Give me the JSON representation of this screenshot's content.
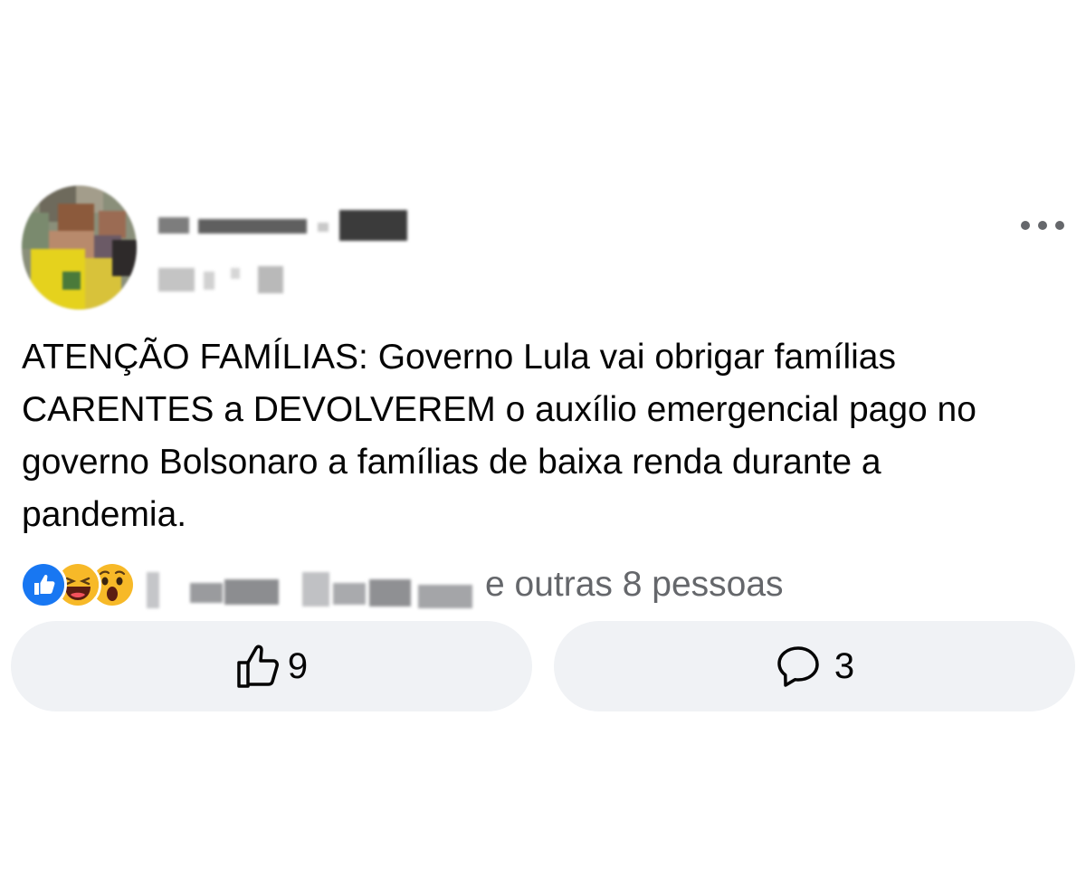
{
  "post": {
    "author_name": "",
    "timestamp": "",
    "text": "ATENÇÃO FAMÍLIAS: Governo Lula vai obrigar famílias CARENTES a DEVOLVEREM o auxílio emergencial pago no governo Bolsonaro a famílias de baixa renda durante a pandemia.",
    "more_icon": "ellipsis-icon"
  },
  "reactions": {
    "icons": [
      "like-icon",
      "haha-icon",
      "wow-icon"
    ],
    "others_text": "e outras 8 pessoas"
  },
  "actions": {
    "like_count": "9",
    "comment_count": "3",
    "like_icon": "thumbs-up-outline-icon",
    "comment_icon": "speech-bubble-icon"
  },
  "colors": {
    "background": "#ffffff",
    "button_bg": "#f0f2f5",
    "secondary_text": "#65676b",
    "like_blue": "#1877f2",
    "emoji_yellow": "#f7b928"
  }
}
